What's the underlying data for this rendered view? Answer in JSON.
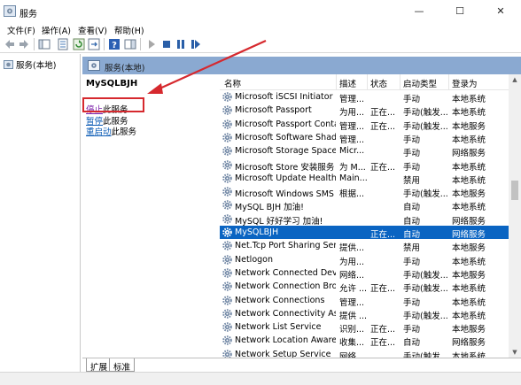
{
  "window": {
    "title": "服务",
    "minimize": "—",
    "maximize": "☐",
    "close": "✕"
  },
  "menu": {
    "file": "文件(F)",
    "action": "操作(A)",
    "view": "查看(V)",
    "help": "帮助(H)"
  },
  "tree": {
    "root_label": "服务(本地)"
  },
  "panel": {
    "header": "服务(本地)"
  },
  "description": {
    "service_name": "MySQLBJH",
    "stop_link": "停止",
    "stop_suffix": "此服务",
    "pause_link": "暂停",
    "pause_suffix": "此服务",
    "restart_link": "重启动",
    "restart_suffix": "此服务"
  },
  "table": {
    "headers": {
      "name": "名称",
      "description": "描述",
      "status": "状态",
      "startup": "启动类型",
      "logon": "登录为"
    },
    "rows": [
      {
        "name": "Microsoft iSCSI Initiator Ser...",
        "description": "管理...",
        "status": "",
        "startup": "手动",
        "logon": "本地系统"
      },
      {
        "name": "Microsoft Passport",
        "description": "为用...",
        "status": "正在...",
        "startup": "手动(触发...",
        "logon": "本地系统"
      },
      {
        "name": "Microsoft Passport Container",
        "description": "管理...",
        "status": "正在...",
        "startup": "手动(触发...",
        "logon": "本地服务"
      },
      {
        "name": "Microsoft Software Shado...",
        "description": "管理...",
        "status": "",
        "startup": "手动",
        "logon": "本地系统"
      },
      {
        "name": "Microsoft Storage Spaces S...",
        "description": "Micr...",
        "status": "",
        "startup": "手动",
        "logon": "网络服务"
      },
      {
        "name": "Microsoft Store 安装服务",
        "description": "为 M...",
        "status": "正在...",
        "startup": "手动",
        "logon": "本地系统"
      },
      {
        "name": "Microsoft Update Health S...",
        "description": "Main...",
        "status": "",
        "startup": "禁用",
        "logon": "本地系统"
      },
      {
        "name": "Microsoft Windows SMS 路...",
        "description": "根据...",
        "status": "",
        "startup": "手动(触发...",
        "logon": "本地服务"
      },
      {
        "name": "MySQL BJH 加油!",
        "description": "",
        "status": "",
        "startup": "自动",
        "logon": "本地系统"
      },
      {
        "name": "MySQL 好好学习 加油!",
        "description": "",
        "status": "",
        "startup": "自动",
        "logon": "网络服务"
      },
      {
        "name": "MySQLBJH",
        "description": "",
        "status": "正在...",
        "startup": "自动",
        "logon": "网络服务",
        "selected": true
      },
      {
        "name": "Net.Tcp Port Sharing Service",
        "description": "提供...",
        "status": "",
        "startup": "禁用",
        "logon": "本地服务"
      },
      {
        "name": "Netlogon",
        "description": "为用...",
        "status": "",
        "startup": "手动",
        "logon": "本地系统"
      },
      {
        "name": "Network Connected Devic...",
        "description": "网络...",
        "status": "",
        "startup": "手动(触发...",
        "logon": "本地服务"
      },
      {
        "name": "Network Connection Broker",
        "description": "允许 ...",
        "status": "正在...",
        "startup": "手动(触发...",
        "logon": "本地系统"
      },
      {
        "name": "Network Connections",
        "description": "管理...",
        "status": "",
        "startup": "手动",
        "logon": "本地系统"
      },
      {
        "name": "Network Connectivity Assis...",
        "description": "提供 ...",
        "status": "",
        "startup": "手动(触发...",
        "logon": "本地系统"
      },
      {
        "name": "Network List Service",
        "description": "识别...",
        "status": "正在...",
        "startup": "手动",
        "logon": "本地服务"
      },
      {
        "name": "Network Location Awarene...",
        "description": "收集...",
        "status": "正在...",
        "startup": "自动",
        "logon": "网络服务"
      },
      {
        "name": "Network Setup Service",
        "description": "网络...",
        "status": "",
        "startup": "手动(触发...",
        "logon": "本地系统"
      }
    ]
  },
  "tabs": {
    "extended": "扩展",
    "standard": "标准"
  },
  "colors": {
    "selection": "#0a64c2",
    "panel_header": "#8aa9d1",
    "annotation_red": "#d6292e",
    "link": "#0b5bb5"
  }
}
